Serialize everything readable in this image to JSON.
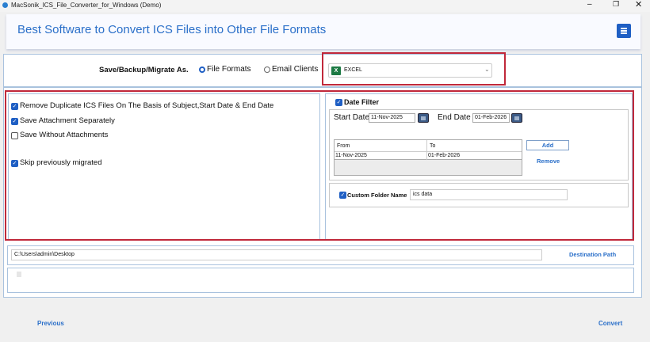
{
  "window": {
    "title": "MacSonik_ICS_File_Converter_for_Windows (Demo)",
    "controls": [
      "minimize",
      "maximize",
      "close"
    ]
  },
  "header": {
    "title": "Best Software to Convert ICS Files into Other File Formats",
    "menu_icon": "hamburger-menu-icon"
  },
  "save_as": {
    "label": "Save/Backup/Migrate As.",
    "options": [
      {
        "label": "File Formats",
        "selected": true
      },
      {
        "label": "Email Clients",
        "selected": false
      }
    ],
    "format": {
      "value": "EXCEL",
      "icon": "excel-icon"
    }
  },
  "options": [
    {
      "label": "Remove Duplicate ICS Files On The Basis of Subject,Start Date & End Date",
      "checked": true
    },
    {
      "label": "Save Attachment Separately",
      "checked": true
    },
    {
      "label": "Save Without Attachments",
      "checked": false
    },
    {
      "label": "Skip previously migrated",
      "checked": true
    }
  ],
  "date_filter": {
    "label": "Date Filter",
    "checked": true,
    "start_label": "Start Date :",
    "start_value": "11-Nov-2025",
    "end_label": "End Date :",
    "end_value": "01-Feb-2026",
    "table": {
      "headers": [
        "From",
        "To"
      ],
      "rows": [
        [
          "11-Nov-2025",
          "01-Feb-2026"
        ]
      ]
    },
    "add": "Add",
    "remove": "Remove"
  },
  "custom_folder": {
    "label": "Custom Folder Name",
    "checked": true,
    "value": "ics data"
  },
  "destination": {
    "path": "C:\\Users\\admin\\Desktop",
    "button": "Destination Path"
  },
  "footer": {
    "previous": "Previous",
    "convert": "Convert"
  },
  "colors": {
    "accent": "#2a6fc9",
    "highlight": "#c0283a"
  }
}
